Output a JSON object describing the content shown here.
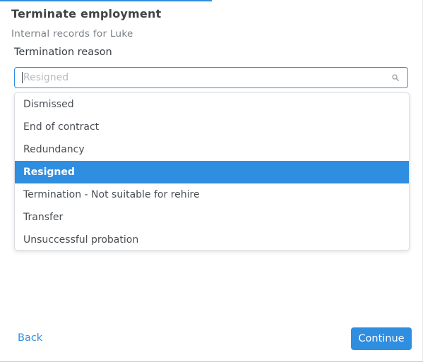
{
  "modal": {
    "title": "Terminate employment",
    "subtitle": "Internal records for Luke"
  },
  "field": {
    "label": "Termination reason",
    "placeholder": "Resigned",
    "icon": "search-icon"
  },
  "options": [
    {
      "label": "Dismissed",
      "selected": false
    },
    {
      "label": "End of contract",
      "selected": false
    },
    {
      "label": "Redundancy",
      "selected": false
    },
    {
      "label": "Resigned",
      "selected": true
    },
    {
      "label": "Termination - Not suitable for rehire",
      "selected": false
    },
    {
      "label": "Transfer",
      "selected": false
    },
    {
      "label": "Unsuccessful probation",
      "selected": false
    }
  ],
  "footer": {
    "back_label": "Back",
    "continue_label": "Continue"
  },
  "colors": {
    "accent": "#2f8ee0"
  }
}
